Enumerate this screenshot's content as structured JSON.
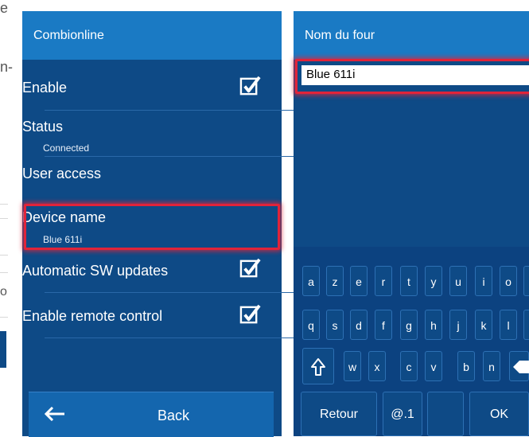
{
  "left_strip": {
    "fragment_1": "e",
    "fragment_2": "n-",
    "fragment_3": "o"
  },
  "settings": {
    "title": "Combionline",
    "items": [
      {
        "label": "Enable",
        "sub": "",
        "checked": true
      },
      {
        "label": "Status",
        "sub": "Connected"
      },
      {
        "label": "User access",
        "sub": ""
      },
      {
        "label": "Device name",
        "sub": "Blue 611i",
        "highlighted": true
      },
      {
        "label": "Automatic SW updates",
        "sub": "",
        "checked": true
      },
      {
        "label": "Enable remote control",
        "sub": "",
        "checked": true
      }
    ],
    "back_label": "Back",
    "back_icon": "arrow-left-icon"
  },
  "rename": {
    "title": "Nom du four",
    "input_value": "Blue 611i",
    "keyboard": {
      "row1": [
        "a",
        "z",
        "e",
        "r",
        "t",
        "y",
        "u",
        "i",
        "o"
      ],
      "row2": [
        "q",
        "s",
        "d",
        "f",
        "g",
        "h",
        "j",
        "k",
        "l"
      ],
      "row3": [
        "w",
        "x",
        "c",
        "v",
        "b",
        "n"
      ],
      "shift_icon": "shift-arrow-icon",
      "backspace_icon": "backspace-icon",
      "bottom": {
        "back": "Retour",
        "symbols": "@.1",
        "ok": "OK"
      }
    }
  },
  "colors": {
    "panel": "#0e4a86",
    "header": "#1a7ac4",
    "highlight": "#e0243a"
  }
}
